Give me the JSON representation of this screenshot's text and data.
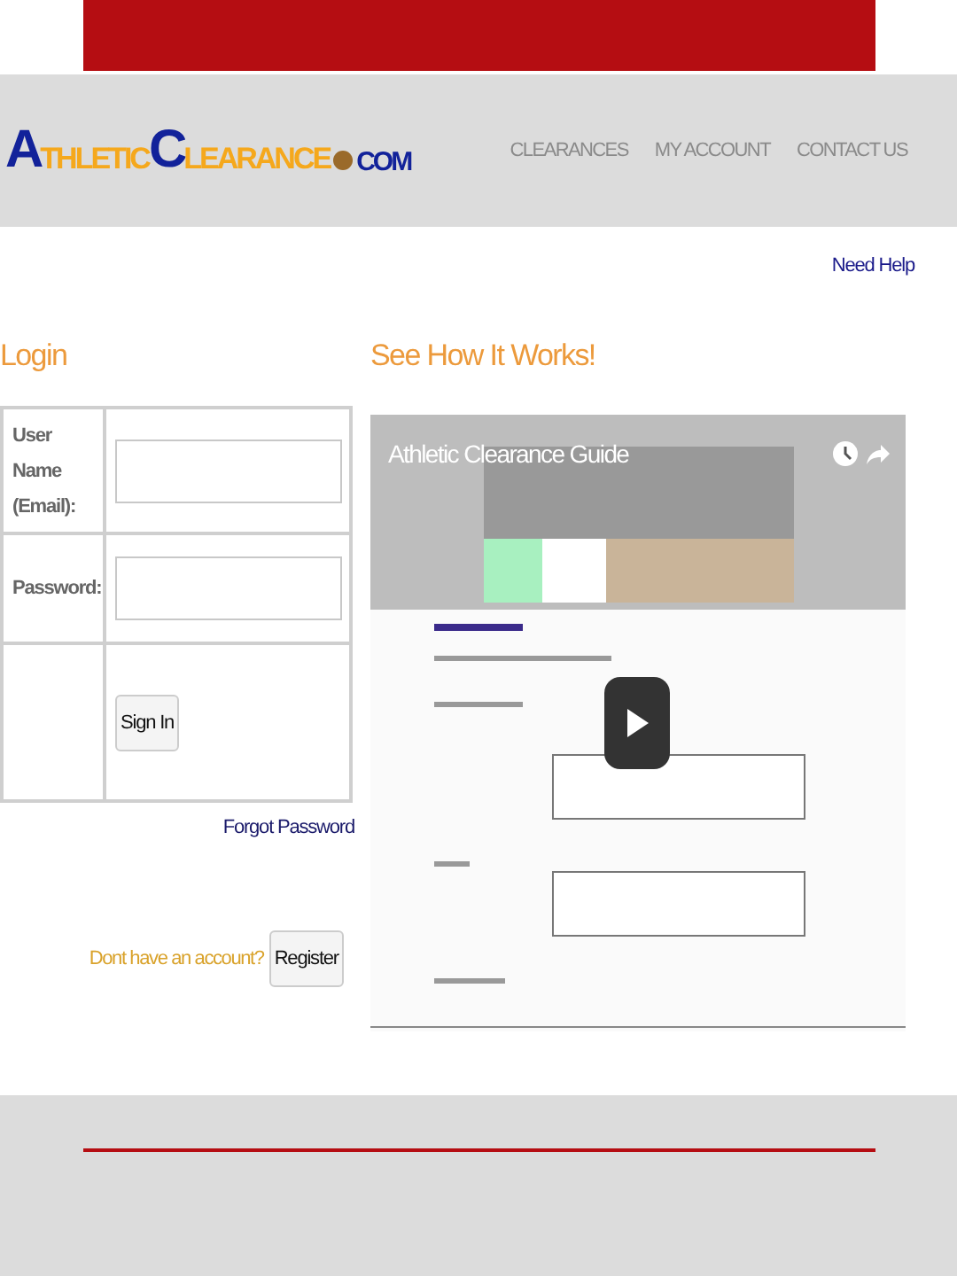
{
  "logo": {
    "parts": [
      {
        "text": "A",
        "kind": "initial"
      },
      {
        "text": "THLETIC",
        "kind": "rest"
      },
      {
        "text": "C",
        "kind": "initial"
      },
      {
        "text": "LEARANCE",
        "kind": "rest"
      },
      {
        "text": "COM",
        "kind": "domain"
      }
    ]
  },
  "nav": [
    "CLEARANCES",
    "MY ACCOUNT",
    "CONTACT US"
  ],
  "help_link": "Need Help",
  "login": {
    "title": "Login",
    "username_label": "User Name (Email):",
    "password_label": "Password:",
    "sign_in": "Sign In",
    "forgot": "Forgot Password",
    "no_account": "Dont have an account?",
    "register": "Register"
  },
  "video": {
    "heading": "See How It Works!",
    "title": "Athletic Clearance Guide",
    "kind": "picture"
  }
}
